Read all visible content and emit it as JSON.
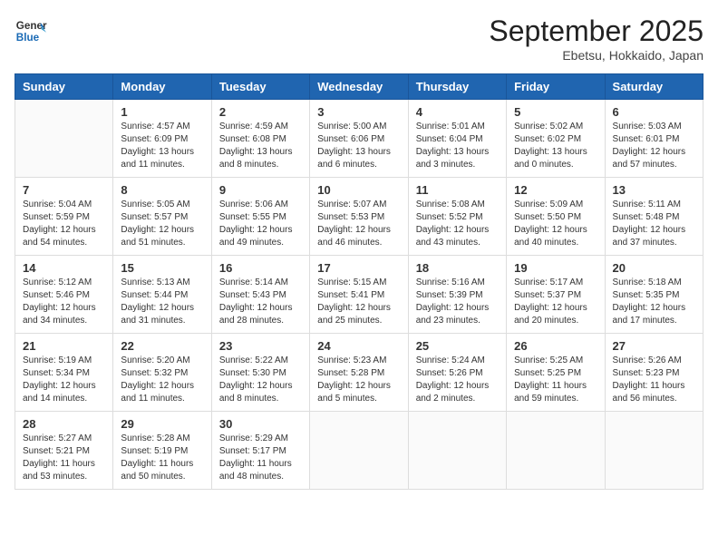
{
  "header": {
    "logo_line1": "General",
    "logo_line2": "Blue",
    "month": "September 2025",
    "location": "Ebetsu, Hokkaido, Japan"
  },
  "weekdays": [
    "Sunday",
    "Monday",
    "Tuesday",
    "Wednesday",
    "Thursday",
    "Friday",
    "Saturday"
  ],
  "weeks": [
    [
      {
        "day": "",
        "info": ""
      },
      {
        "day": "1",
        "info": "Sunrise: 4:57 AM\nSunset: 6:09 PM\nDaylight: 13 hours\nand 11 minutes."
      },
      {
        "day": "2",
        "info": "Sunrise: 4:59 AM\nSunset: 6:08 PM\nDaylight: 13 hours\nand 8 minutes."
      },
      {
        "day": "3",
        "info": "Sunrise: 5:00 AM\nSunset: 6:06 PM\nDaylight: 13 hours\nand 6 minutes."
      },
      {
        "day": "4",
        "info": "Sunrise: 5:01 AM\nSunset: 6:04 PM\nDaylight: 13 hours\nand 3 minutes."
      },
      {
        "day": "5",
        "info": "Sunrise: 5:02 AM\nSunset: 6:02 PM\nDaylight: 13 hours\nand 0 minutes."
      },
      {
        "day": "6",
        "info": "Sunrise: 5:03 AM\nSunset: 6:01 PM\nDaylight: 12 hours\nand 57 minutes."
      }
    ],
    [
      {
        "day": "7",
        "info": "Sunrise: 5:04 AM\nSunset: 5:59 PM\nDaylight: 12 hours\nand 54 minutes."
      },
      {
        "day": "8",
        "info": "Sunrise: 5:05 AM\nSunset: 5:57 PM\nDaylight: 12 hours\nand 51 minutes."
      },
      {
        "day": "9",
        "info": "Sunrise: 5:06 AM\nSunset: 5:55 PM\nDaylight: 12 hours\nand 49 minutes."
      },
      {
        "day": "10",
        "info": "Sunrise: 5:07 AM\nSunset: 5:53 PM\nDaylight: 12 hours\nand 46 minutes."
      },
      {
        "day": "11",
        "info": "Sunrise: 5:08 AM\nSunset: 5:52 PM\nDaylight: 12 hours\nand 43 minutes."
      },
      {
        "day": "12",
        "info": "Sunrise: 5:09 AM\nSunset: 5:50 PM\nDaylight: 12 hours\nand 40 minutes."
      },
      {
        "day": "13",
        "info": "Sunrise: 5:11 AM\nSunset: 5:48 PM\nDaylight: 12 hours\nand 37 minutes."
      }
    ],
    [
      {
        "day": "14",
        "info": "Sunrise: 5:12 AM\nSunset: 5:46 PM\nDaylight: 12 hours\nand 34 minutes."
      },
      {
        "day": "15",
        "info": "Sunrise: 5:13 AM\nSunset: 5:44 PM\nDaylight: 12 hours\nand 31 minutes."
      },
      {
        "day": "16",
        "info": "Sunrise: 5:14 AM\nSunset: 5:43 PM\nDaylight: 12 hours\nand 28 minutes."
      },
      {
        "day": "17",
        "info": "Sunrise: 5:15 AM\nSunset: 5:41 PM\nDaylight: 12 hours\nand 25 minutes."
      },
      {
        "day": "18",
        "info": "Sunrise: 5:16 AM\nSunset: 5:39 PM\nDaylight: 12 hours\nand 23 minutes."
      },
      {
        "day": "19",
        "info": "Sunrise: 5:17 AM\nSunset: 5:37 PM\nDaylight: 12 hours\nand 20 minutes."
      },
      {
        "day": "20",
        "info": "Sunrise: 5:18 AM\nSunset: 5:35 PM\nDaylight: 12 hours\nand 17 minutes."
      }
    ],
    [
      {
        "day": "21",
        "info": "Sunrise: 5:19 AM\nSunset: 5:34 PM\nDaylight: 12 hours\nand 14 minutes."
      },
      {
        "day": "22",
        "info": "Sunrise: 5:20 AM\nSunset: 5:32 PM\nDaylight: 12 hours\nand 11 minutes."
      },
      {
        "day": "23",
        "info": "Sunrise: 5:22 AM\nSunset: 5:30 PM\nDaylight: 12 hours\nand 8 minutes."
      },
      {
        "day": "24",
        "info": "Sunrise: 5:23 AM\nSunset: 5:28 PM\nDaylight: 12 hours\nand 5 minutes."
      },
      {
        "day": "25",
        "info": "Sunrise: 5:24 AM\nSunset: 5:26 PM\nDaylight: 12 hours\nand 2 minutes."
      },
      {
        "day": "26",
        "info": "Sunrise: 5:25 AM\nSunset: 5:25 PM\nDaylight: 11 hours\nand 59 minutes."
      },
      {
        "day": "27",
        "info": "Sunrise: 5:26 AM\nSunset: 5:23 PM\nDaylight: 11 hours\nand 56 minutes."
      }
    ],
    [
      {
        "day": "28",
        "info": "Sunrise: 5:27 AM\nSunset: 5:21 PM\nDaylight: 11 hours\nand 53 minutes."
      },
      {
        "day": "29",
        "info": "Sunrise: 5:28 AM\nSunset: 5:19 PM\nDaylight: 11 hours\nand 50 minutes."
      },
      {
        "day": "30",
        "info": "Sunrise: 5:29 AM\nSunset: 5:17 PM\nDaylight: 11 hours\nand 48 minutes."
      },
      {
        "day": "",
        "info": ""
      },
      {
        "day": "",
        "info": ""
      },
      {
        "day": "",
        "info": ""
      },
      {
        "day": "",
        "info": ""
      }
    ]
  ]
}
